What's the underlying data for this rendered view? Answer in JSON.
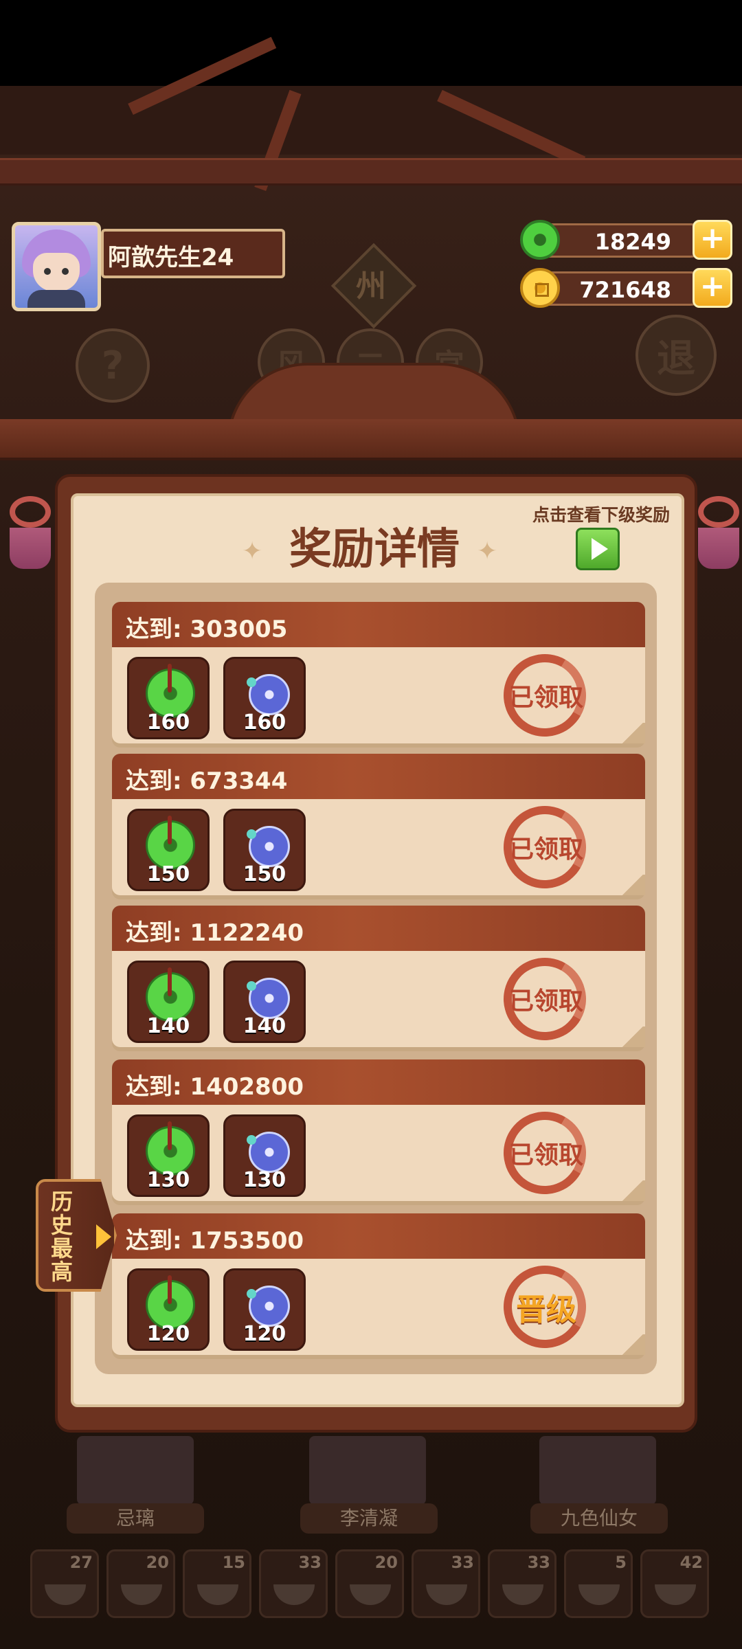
{
  "player": {
    "name": "阿歆先生24"
  },
  "resources": [
    {
      "icon": "jade-coin-icon",
      "value": "18249"
    },
    {
      "icon": "gold-coin-icon",
      "value": "721648"
    }
  ],
  "background": {
    "sign_char": "州",
    "help_char": "?",
    "exit_char": "退",
    "tab_chars": [
      "风",
      "二",
      "宫"
    ]
  },
  "side_tab": {
    "label": "历史最高"
  },
  "modal": {
    "title": "奖励详情",
    "next_hint": "点击查看下级奖励",
    "rows": [
      {
        "label": "达到: 303005",
        "jade": "160",
        "disc": "160",
        "status": "已领取"
      },
      {
        "label": "达到: 673344",
        "jade": "150",
        "disc": "150",
        "status": "已领取"
      },
      {
        "label": "达到: 1122240",
        "jade": "140",
        "disc": "140",
        "status": "已领取"
      },
      {
        "label": "达到: 1402800",
        "jade": "130",
        "disc": "130",
        "status": "已领取"
      },
      {
        "label": "达到: 1753500",
        "jade": "120",
        "disc": "120",
        "status": "晋级"
      }
    ]
  },
  "characters": [
    "忌璃",
    "李清凝",
    "九色仙女"
  ],
  "dishes": [
    "27",
    "20",
    "15",
    "33",
    "20",
    "33",
    "33",
    "5",
    "42"
  ]
}
